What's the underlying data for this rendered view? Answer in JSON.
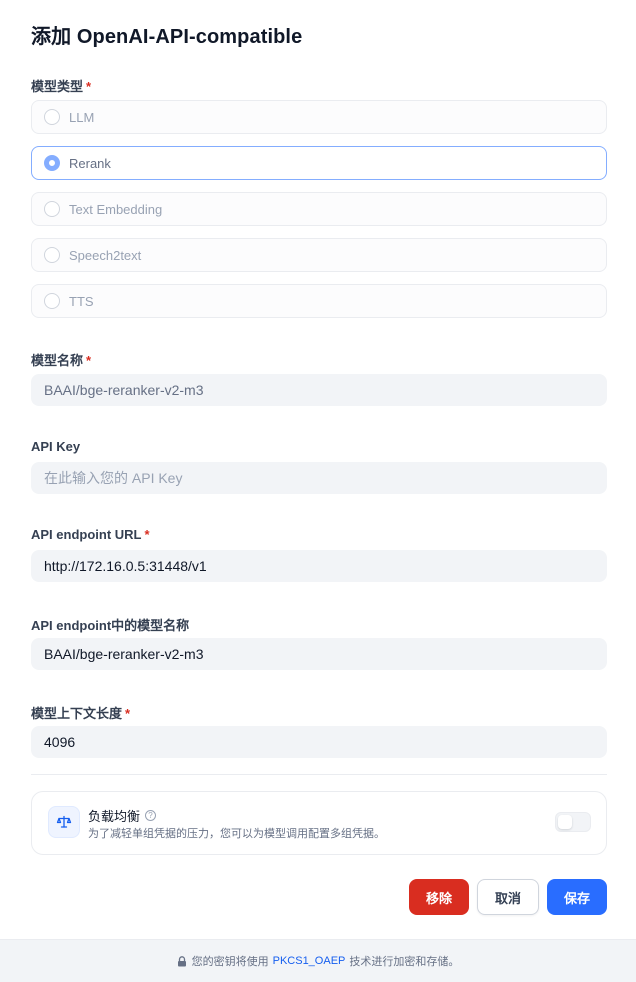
{
  "dialog": {
    "title": "添加 OpenAI-API-compatible"
  },
  "model_type": {
    "label": "模型类型",
    "required_mark": "*",
    "options": [
      {
        "label": "LLM",
        "selected": false
      },
      {
        "label": "Rerank",
        "selected": true
      },
      {
        "label": "Text Embedding",
        "selected": false
      },
      {
        "label": "Speech2text",
        "selected": false
      },
      {
        "label": "TTS",
        "selected": false
      }
    ]
  },
  "model_name": {
    "label": "模型名称",
    "required_mark": "*",
    "value": "BAAI/bge-reranker-v2-m3"
  },
  "api_key": {
    "label": "API Key",
    "placeholder": "在此输入您的 API Key",
    "value": ""
  },
  "endpoint_url": {
    "label": "API endpoint URL",
    "required_mark": "*",
    "value": "http://172.16.0.5:31448/v1"
  },
  "endpoint_model_name": {
    "label": "API endpoint中的模型名称",
    "value": "BAAI/bge-reranker-v2-m3"
  },
  "context_length": {
    "label": "模型上下文长度",
    "required_mark": "*",
    "value": "4096"
  },
  "load_balancing": {
    "title": "负载均衡",
    "help_icon": "question-circle-icon",
    "description": "为了减轻单组凭据的压力，您可以为模型调用配置多组凭据。",
    "enabled": false,
    "icon": "balance-scale-icon"
  },
  "buttons": {
    "remove": "移除",
    "cancel": "取消",
    "save": "保存"
  },
  "footer": {
    "lock_icon": "lock-icon",
    "prefix": "您的密钥将使用",
    "link": "PKCS1_OAEP",
    "suffix": "技术进行加密和存储。"
  },
  "colors": {
    "primary": "#296dff",
    "danger": "#d92d20",
    "selected_border": "#84adff",
    "link": "#155eef"
  }
}
